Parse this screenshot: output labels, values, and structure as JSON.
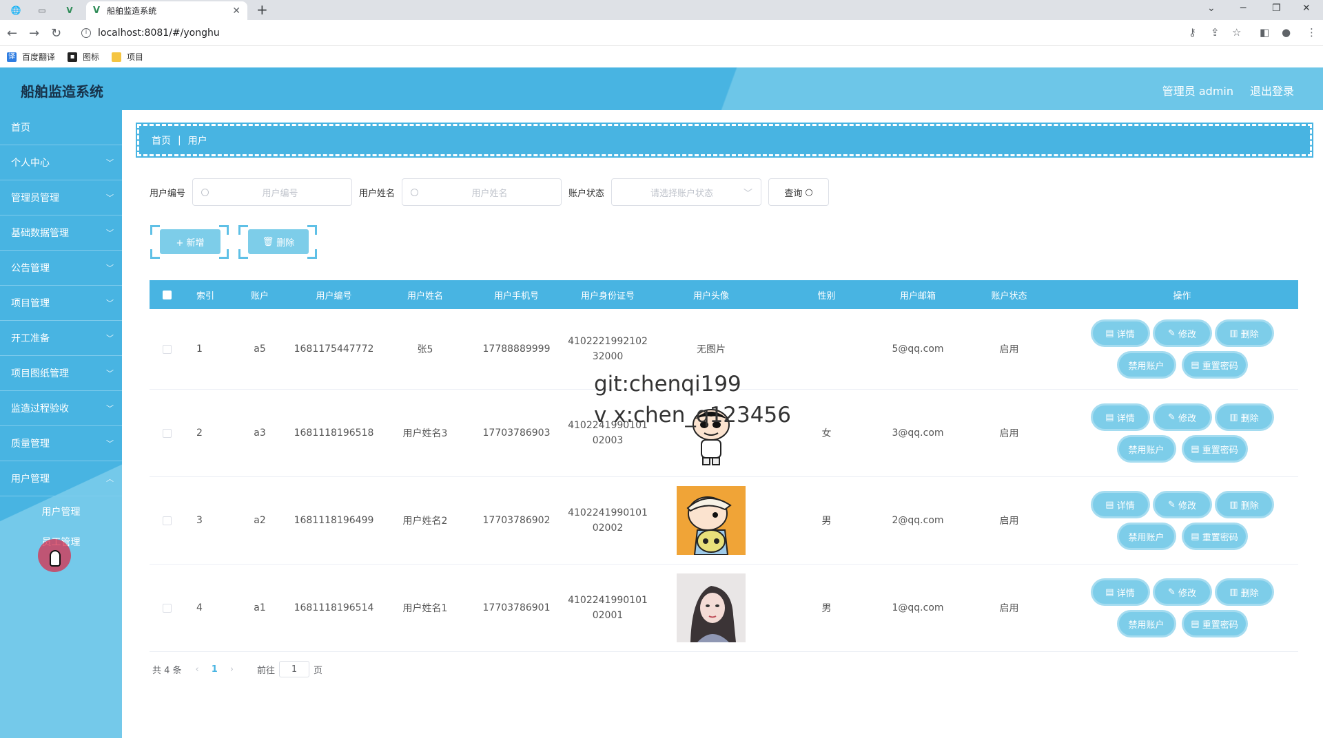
{
  "browser": {
    "tab_title": "船舶监造系统",
    "url": "localhost:8081/#/yonghu",
    "bookmarks": [
      "百度翻译",
      "图标",
      "项目"
    ]
  },
  "header": {
    "title": "船舶监造系统",
    "admin_label": "管理员 admin",
    "logout_label": "退出登录"
  },
  "sidebar": {
    "items": [
      {
        "label": "首页"
      },
      {
        "label": "个人中心"
      },
      {
        "label": "管理员管理"
      },
      {
        "label": "基础数据管理"
      },
      {
        "label": "公告管理"
      },
      {
        "label": "项目管理"
      },
      {
        "label": "开工准备"
      },
      {
        "label": "项目图纸管理"
      },
      {
        "label": "监造过程验收"
      },
      {
        "label": "质量管理"
      },
      {
        "label": "用户管理"
      }
    ],
    "subitems": [
      {
        "label": "用户管理"
      },
      {
        "label": "员工管理"
      }
    ]
  },
  "breadcrumb": {
    "home": "首页",
    "current": "用户"
  },
  "search": {
    "code_label": "用户编号",
    "code_placeholder": "用户编号",
    "name_label": "用户姓名",
    "name_placeholder": "用户姓名",
    "state_label": "账户状态",
    "state_placeholder": "请选择账户状态",
    "query_label": "查询"
  },
  "actions": {
    "add": "+ 新增",
    "delete": "删除"
  },
  "table": {
    "headers": [
      "索引",
      "账户",
      "用户编号",
      "用户姓名",
      "用户手机号",
      "用户身份证号",
      "用户头像",
      "性别",
      "用户邮箱",
      "账户状态",
      "操作"
    ],
    "rows": [
      {
        "index": "1",
        "account": "a5",
        "code": "1681175447772",
        "name": "张5",
        "phone": "17788889999",
        "id_line1": "4102221992102",
        "id_line2": "32000",
        "avatar": "无图片",
        "sex": "",
        "email": "5@qq.com",
        "state": "启用"
      },
      {
        "index": "2",
        "account": "a3",
        "code": "1681118196518",
        "name": "用户姓名3",
        "phone": "17703786903",
        "id_line1": "4102241990101",
        "id_line2": "02003",
        "avatar": "",
        "sex": "女",
        "email": "3@qq.com",
        "state": "启用"
      },
      {
        "index": "3",
        "account": "a2",
        "code": "1681118196499",
        "name": "用户姓名2",
        "phone": "17703786902",
        "id_line1": "4102241990101",
        "id_line2": "02002",
        "avatar": "",
        "sex": "男",
        "email": "2@qq.com",
        "state": "启用"
      },
      {
        "index": "4",
        "account": "a1",
        "code": "1681118196514",
        "name": "用户姓名1",
        "phone": "17703786901",
        "id_line1": "4102241990101",
        "id_line2": "02001",
        "avatar": "",
        "sex": "男",
        "email": "1@qq.com",
        "state": "启用"
      }
    ],
    "ops": {
      "detail": "详情",
      "edit": "修改",
      "delete": "删除",
      "disable": "禁用账户",
      "reset": "重置密码"
    }
  },
  "pagination": {
    "total": "共 4 条",
    "current": "1",
    "goto": "前往",
    "page_value": "1",
    "page_unit": "页"
  },
  "watermark": {
    "line1": "git:chenqi199",
    "line2": "v x:chen_q123456"
  }
}
